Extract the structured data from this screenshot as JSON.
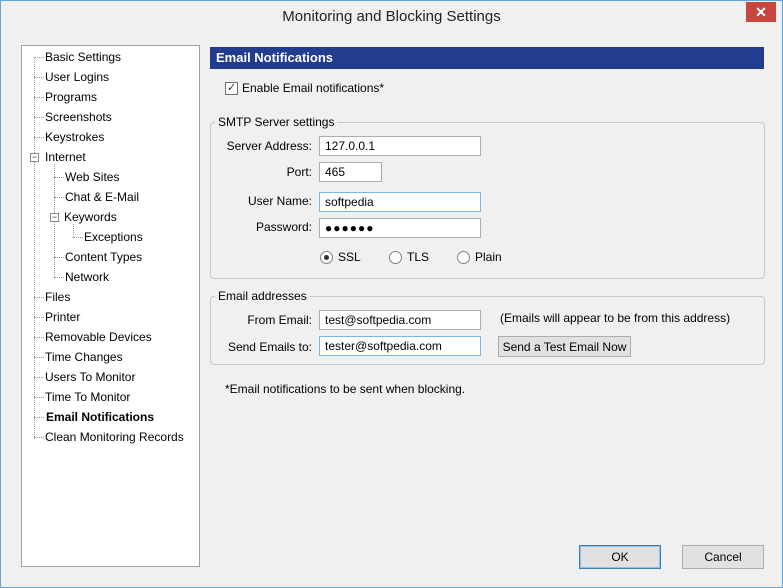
{
  "window": {
    "title": "Monitoring and Blocking Settings",
    "close_glyph": "✕"
  },
  "tree": {
    "items": [
      {
        "label": "Basic Settings"
      },
      {
        "label": "User Logins"
      },
      {
        "label": "Programs"
      },
      {
        "label": "Screenshots"
      },
      {
        "label": "Keystrokes"
      },
      {
        "label": "Internet",
        "expander": "−"
      },
      {
        "label": "Web Sites"
      },
      {
        "label": "Chat & E-Mail"
      },
      {
        "label": "Keywords",
        "expander": "−"
      },
      {
        "label": "Exceptions"
      },
      {
        "label": "Content Types"
      },
      {
        "label": "Network"
      },
      {
        "label": "Files"
      },
      {
        "label": "Printer"
      },
      {
        "label": "Removable Devices"
      },
      {
        "label": "Time Changes"
      },
      {
        "label": "Users To Monitor"
      },
      {
        "label": "Time To Monitor"
      },
      {
        "label": "Email Notifications",
        "selected": true
      },
      {
        "label": "Clean Monitoring Records"
      }
    ]
  },
  "panel": {
    "header": "Email Notifications",
    "enable_checkbox": {
      "label": "Enable Email notifications*",
      "checked": true,
      "check_glyph": "✓"
    },
    "smtp": {
      "title": "SMTP Server settings",
      "server_address_label": "Server Address:",
      "server_address_value": "127.0.0.1",
      "port_label": "Port:",
      "port_value": "465",
      "username_label": "User Name:",
      "username_value": "softpedia",
      "password_label": "Password:",
      "password_value": "●●●●●●",
      "security_options": [
        {
          "label": "SSL",
          "checked": true
        },
        {
          "label": "TLS",
          "checked": false
        },
        {
          "label": "Plain",
          "checked": false
        }
      ]
    },
    "email": {
      "title": "Email addresses",
      "from_label": "From Email:",
      "from_value": "test@softpedia.com",
      "from_hint": "(Emails will appear to be from this address)",
      "to_label": "Send Emails to:",
      "to_value": "tester@softpedia.com",
      "test_button": "Send a Test Email Now"
    },
    "footnote": "*Email notifications to be sent when blocking."
  },
  "buttons": {
    "ok": "OK",
    "cancel": "Cancel"
  },
  "colors": {
    "header_bg": "#223d8f",
    "window_border": "#5fa6de",
    "close_bg": "#c7463f"
  }
}
